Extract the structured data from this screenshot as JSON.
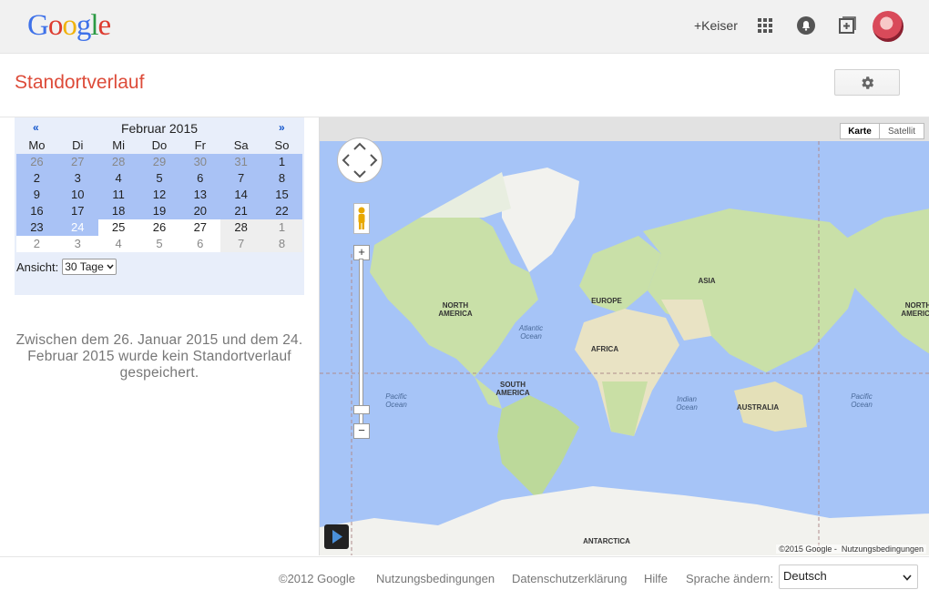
{
  "header": {
    "logo_letters": [
      "G",
      "o",
      "o",
      "g",
      "l",
      "e"
    ],
    "logo_colors": [
      "#3f72e9",
      "#dd3b2f",
      "#f0b20b",
      "#3f72e9",
      "#2b9a43",
      "#dd3b2f"
    ],
    "user_link": "+Keiser",
    "icons": [
      "apps-grid-icon",
      "notifications-bell-icon",
      "add-share-icon",
      "avatar"
    ]
  },
  "page": {
    "title": "Standortverlauf",
    "settings_icon": "gear-icon"
  },
  "calendar": {
    "prev": "«",
    "next": "»",
    "month": "Februar 2015",
    "weekdays": [
      "Mo",
      "Di",
      "Mi",
      "Do",
      "Fr",
      "Sa",
      "So"
    ],
    "weeks": [
      [
        "26",
        "27",
        "28",
        "29",
        "30",
        "31",
        "1"
      ],
      [
        "2",
        "3",
        "4",
        "5",
        "6",
        "7",
        "8"
      ],
      [
        "9",
        "10",
        "11",
        "12",
        "13",
        "14",
        "15"
      ],
      [
        "16",
        "17",
        "18",
        "19",
        "20",
        "21",
        "22"
      ],
      [
        "23",
        "24",
        "25",
        "26",
        "27",
        "28",
        "1"
      ],
      [
        "2",
        "3",
        "4",
        "5",
        "6",
        "7",
        "8"
      ]
    ],
    "view_label": "Ansicht:",
    "view_value": "30 Tage"
  },
  "message": "Zwischen dem 26. Januar 2015 und dem 24. Februar 2015 wurde kein Standortverlauf gespeichert.",
  "map": {
    "toggle_map": "Karte",
    "toggle_sat": "Satellit",
    "continents": {
      "north_america": "NORTH AMERICA",
      "north_america_right": "NORTH AMERICA",
      "europe": "EUROPE",
      "asia": "ASIA",
      "africa": "AFRICA",
      "south_america": "SOUTH AMERICA",
      "australia": "AUSTRALIA",
      "antarctica": "ANTARCTICA"
    },
    "oceans": {
      "atlantic": "Atlantic Ocean",
      "pacific_left": "Pacific Ocean",
      "indian": "Indian Ocean",
      "pacific_right": "Pacific Ocean"
    },
    "copyright": "©2015 Google -",
    "terms": "Nutzungsbedingungen"
  },
  "footer": {
    "copyright": "©2012 Google",
    "terms": "Nutzungsbedingungen",
    "privacy": "Datenschutzerklärung",
    "help": "Hilfe",
    "language_label": "Sprache ändern:",
    "language_value": "Deutsch"
  }
}
